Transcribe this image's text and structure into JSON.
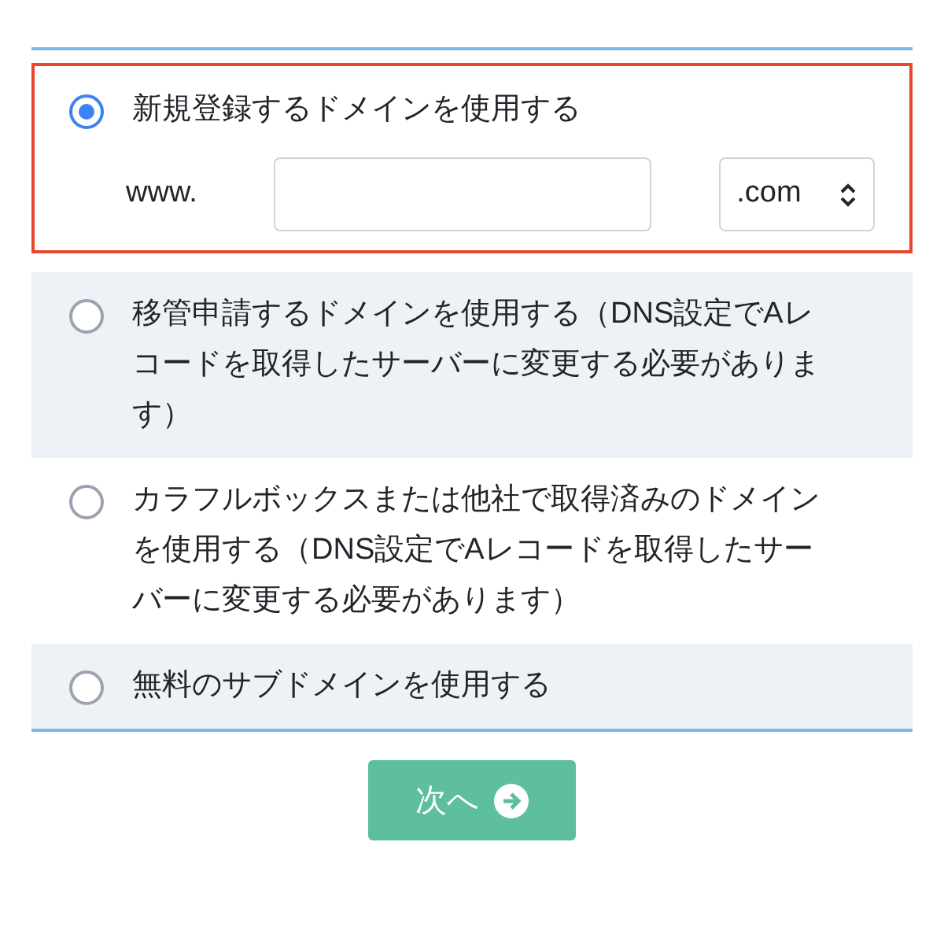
{
  "options": [
    {
      "label": "新規登録するドメインを使用する",
      "selected": true,
      "prefix": "www.",
      "tld_select": {
        "value": ".com"
      }
    },
    {
      "label": "移管申請するドメインを使用する（DNS設定でAレコードを取得したサーバーに変更する必要があります）",
      "selected": false
    },
    {
      "label": "カラフルボックスまたは他社で取得済みのドメインを使用する（DNS設定でAレコードを取得したサーバーに変更する必要があります）",
      "selected": false
    },
    {
      "label": "無料のサブドメインを使用する",
      "selected": false
    }
  ],
  "next_button": {
    "label": "次へ"
  }
}
